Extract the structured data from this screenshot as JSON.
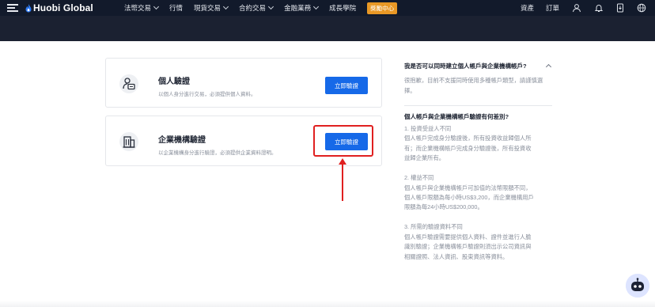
{
  "nav": {
    "logo": "Huobi Global",
    "items": [
      {
        "label": "法幣交易",
        "has_dropdown": true
      },
      {
        "label": "行情",
        "has_dropdown": false
      },
      {
        "label": "現貨交易",
        "has_dropdown": true
      },
      {
        "label": "合約交易",
        "has_dropdown": true
      },
      {
        "label": "金融業務",
        "has_dropdown": true
      },
      {
        "label": "成長學院",
        "has_dropdown": false
      }
    ],
    "badge": "獎勵中心",
    "badge_color": "#e99825",
    "right_links": [
      "資產",
      "訂單"
    ],
    "right_icons": [
      "user-icon",
      "bell-icon",
      "download-icon",
      "globe-icon"
    ]
  },
  "cards": [
    {
      "title": "個人驗證",
      "description": "以個人身分進行交易，必須提供個人資料。",
      "button": "立即驗證",
      "icon": "person-id-icon"
    },
    {
      "title": "企業機構驗證",
      "description": "以企業機構身分進行驗證，必須提供企業資料證明。",
      "button": "立即驗證",
      "icon": "building-icon"
    }
  ],
  "faq": {
    "q1": "我是否可以同時建立個人帳戶與企業機構帳戶?",
    "a1": "很抱歉，目前不支援同時使用多種帳戶類型，請謹慎選擇。",
    "q2": "個人帳戶與企業機構帳戶驗證有何差別?",
    "a2": [
      {
        "heading": "1. 投資受益人不同",
        "lines": [
          "個人帳戶完成身分驗證後，所有投資收益歸個人所",
          "有；而企業機構帳戶完成身分驗證後，所有投資收",
          "益歸企業所有。"
        ]
      },
      {
        "heading": "2. 權益不同",
        "lines": [
          "個人帳戶與企業機構帳戶可加值的法幣限額不同，",
          "個人帳戶限額為每小時US$3,200，而企業機構用戶",
          "限額為每24小時US$200,000。"
        ]
      },
      {
        "heading": "3. 所需的驗證資料不同",
        "lines": [
          "個人帳戶驗證需要提供個人資料、證件並進行人臉",
          "識別驗證；企業機構帳戶驗證則須出示公司資訊與",
          "相關證照、法人資訊、股東資訊等資料。"
        ]
      }
    ]
  },
  "colors": {
    "accent": "#1669e8",
    "highlight": "#e02020",
    "nav_bg": "#121a2b"
  }
}
